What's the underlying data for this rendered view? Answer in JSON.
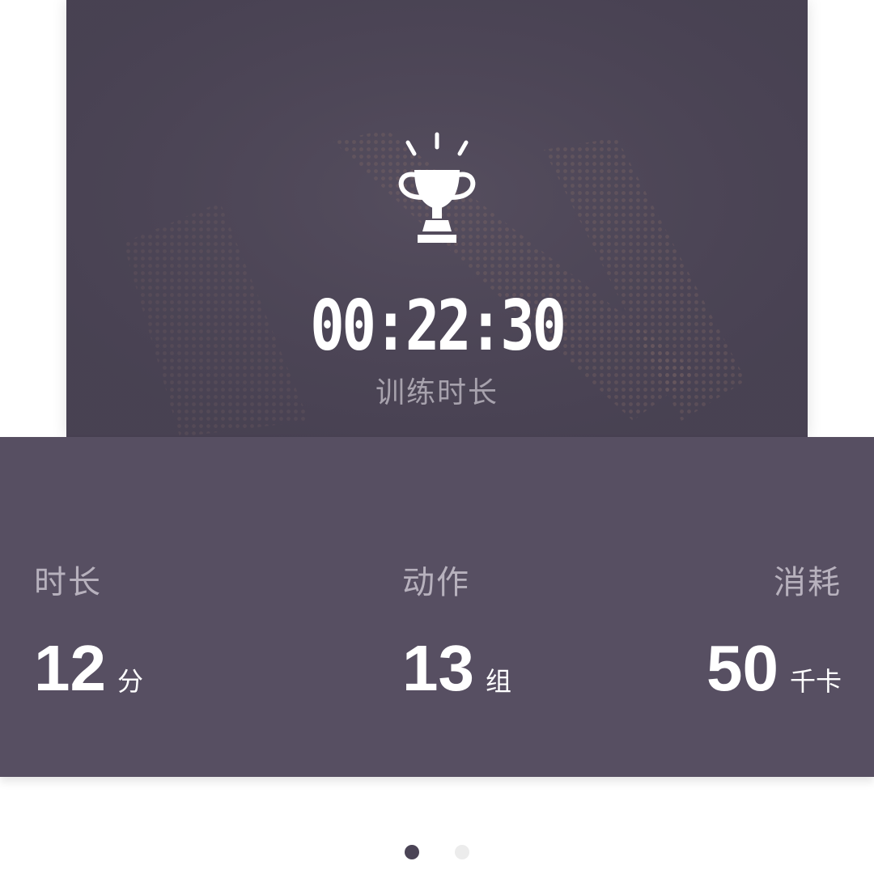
{
  "summary": {
    "training_time": "00:22:30",
    "training_time_label": "训练时长"
  },
  "stats": {
    "duration": {
      "label": "时长",
      "value": "12",
      "unit": "分"
    },
    "actions": {
      "label": "动作",
      "value": "13",
      "unit": "组"
    },
    "calories": {
      "label": "消耗",
      "value": "50",
      "unit": "千卡"
    }
  },
  "pager": {
    "page_count": 2,
    "active_index": 0
  },
  "colors": {
    "hero_background": "#4e4759",
    "stats_background": "#574f62",
    "label_text": "#b7b1bd",
    "value_text": "#ffffff",
    "dot_active": "#4b4456",
    "dot_inactive": "#ececec"
  },
  "icons": {
    "achievement": "trophy-icon"
  }
}
